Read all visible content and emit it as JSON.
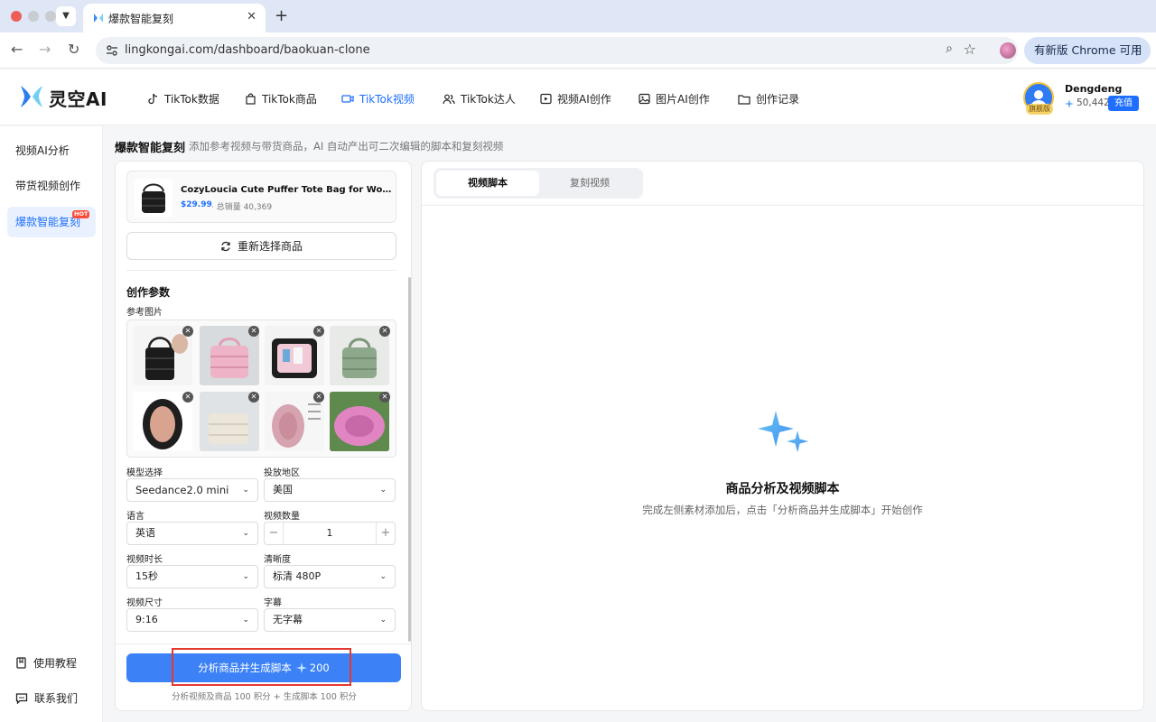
{
  "browser": {
    "tab_title": "爆款智能复刻",
    "url": "lingkongai.com/dashboard/baokuan-clone",
    "update_label": "有新版 Chrome 可用"
  },
  "app": {
    "logo_text": "灵空AI",
    "nav": [
      {
        "label": "TikTok数据",
        "icon": "tiktok-icon"
      },
      {
        "label": "TikTok商品",
        "icon": "bag-icon"
      },
      {
        "label": "TikTok视频",
        "icon": "video-icon",
        "active": true
      },
      {
        "label": "TikTok达人",
        "icon": "users-icon"
      },
      {
        "label": "视频AI创作",
        "icon": "film-icon"
      },
      {
        "label": "图片AI创作",
        "icon": "image-icon"
      },
      {
        "label": "创作记录",
        "icon": "folder-icon"
      }
    ],
    "user": {
      "name": "Dengdeng",
      "badge": "旗舰版",
      "points": "50,442",
      "recharge_label": "充值"
    },
    "accent_color": "#1e6fff"
  },
  "sidebar": {
    "items": [
      {
        "label": "视频AI分析"
      },
      {
        "label": "带货视频创作"
      },
      {
        "label": "爆款智能复刻",
        "active": true,
        "badge": "HOT"
      }
    ],
    "bottom": [
      {
        "label": "使用教程",
        "icon": "book-icon"
      },
      {
        "label": "联系我们",
        "icon": "chat-icon"
      }
    ]
  },
  "page": {
    "title": "爆款智能复刻",
    "subtitle": "添加参考视频与带货商品，AI 自动产出可二次编辑的脚本和复刻视频"
  },
  "left": {
    "product": {
      "name": "CozyLoucia Cute Puffer Tote Bag for Women Pink Quilted Tote",
      "price": "$29.99",
      "sales": "· 总销量 40,369"
    },
    "reselect_label": "重新选择商品",
    "section_title": "创作参数",
    "ref_images_label": "参考图片",
    "ref_image_count": 8,
    "fields": {
      "model": {
        "label": "模型选择",
        "value": "Seedance2.0 mini"
      },
      "region": {
        "label": "投放地区",
        "value": "美国"
      },
      "language": {
        "label": "语言",
        "value": "英语"
      },
      "video_count": {
        "label": "视频数量",
        "value": "1",
        "minus": "−",
        "plus": "+"
      },
      "duration": {
        "label": "视频时长",
        "value": "15秒"
      },
      "resolution": {
        "label": "清晰度",
        "value": "标清 480P"
      },
      "size": {
        "label": "视频尺寸",
        "value": "9:16"
      },
      "subtitle": {
        "label": "字幕",
        "value": "无字幕"
      }
    },
    "generate_label": "分析商品并生成脚本",
    "generate_cost": "200",
    "cost_note": "分析视频及商品 100 积分 + 生成脚本 100 积分"
  },
  "right": {
    "tabs": [
      {
        "label": "视频脚本",
        "active": true
      },
      {
        "label": "复刻视频"
      }
    ],
    "empty_title": "商品分析及视频脚本",
    "empty_desc": "完成左侧素材添加后，点击「分析商品并生成脚本」开始创作"
  }
}
